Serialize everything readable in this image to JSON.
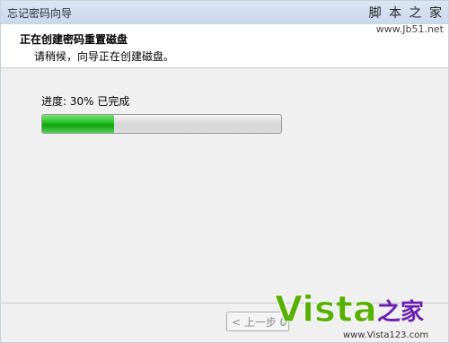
{
  "window": {
    "title": "忘记密码向导"
  },
  "header": {
    "title": "正在创建密码重置磁盘",
    "subtitle": "请稍候，向导正在创建磁盘。"
  },
  "progress": {
    "label": "进度: 30% 已完成",
    "fraction": 0.3
  },
  "footer": {
    "prev_label": "< 上一步 0"
  },
  "watermark_top": {
    "name": "脚 本 之 家",
    "url": "www.Jb51.net"
  },
  "watermark_logo": {
    "brand": "Vista",
    "suffix": "之家",
    "url": "www.Vista123.com"
  },
  "colors": {
    "progress_fill": "#1fbf1f",
    "logo_green": "#58b000",
    "logo_red": "#e02020",
    "logo_purple": "#6a1fb0"
  }
}
